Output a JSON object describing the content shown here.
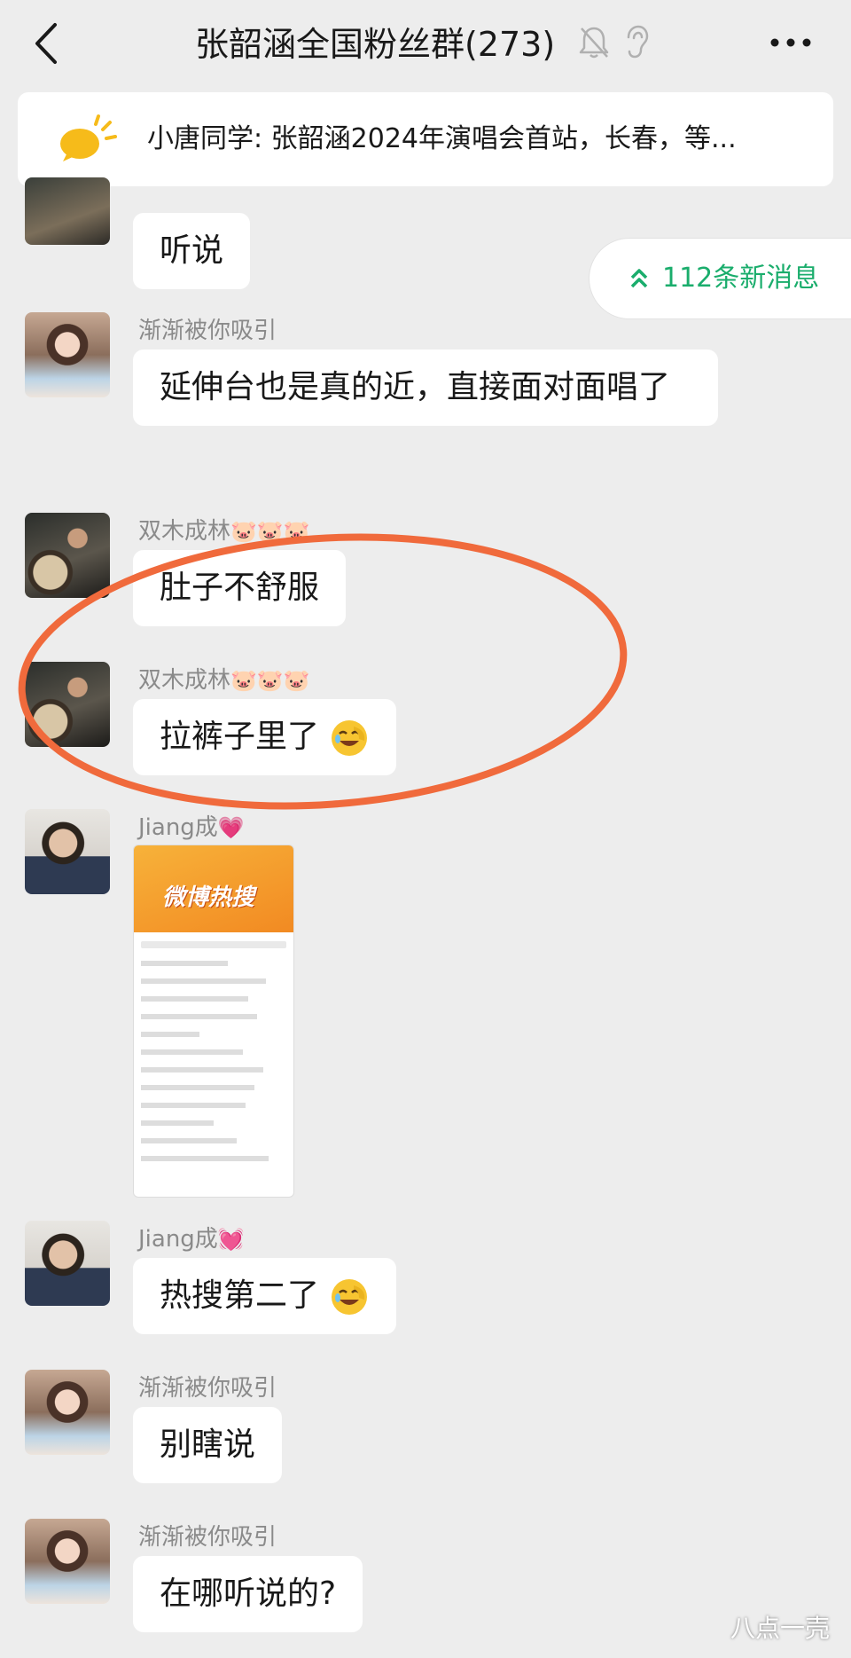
{
  "header": {
    "title": "张韶涵全国粉丝群(273)"
  },
  "pinned_notice": {
    "text": "小唐同学: 张韶涵2024年演唱会首站，长春，等..."
  },
  "new_messages_pill": {
    "label": "112条新消息"
  },
  "messages": [
    {
      "sender": "",
      "text": "听说"
    },
    {
      "sender": "渐渐被你吸引",
      "text": "延伸台也是真的近，直接面对面唱了"
    },
    {
      "sender": "双木成林",
      "sender_emoji": "🐷🐷🐷",
      "text": "肚子不舒服"
    },
    {
      "sender": "双木成林",
      "sender_emoji": "🐷🐷🐷",
      "text": "拉裤子里了",
      "trailing_emoji": "facepalm-laugh"
    },
    {
      "sender": "Jiang成",
      "sender_emoji": "💗",
      "image": "weibo-hot-search-screenshot"
    },
    {
      "sender": "Jiang成",
      "sender_emoji": "💓",
      "text": "热搜第二了",
      "trailing_emoji": "facepalm-laugh"
    },
    {
      "sender": "渐渐被你吸引",
      "text": "别瞎说"
    },
    {
      "sender": "渐渐被你吸引",
      "text": "在哪听说的?"
    }
  ],
  "screenshot_card": {
    "header_text": "微博热搜"
  },
  "watermark": "八点一壳",
  "colors": {
    "background": "#ededed",
    "bubble": "#ffffff",
    "accent_green": "#1aad6c",
    "annotation_circle": "#f06a3c"
  }
}
